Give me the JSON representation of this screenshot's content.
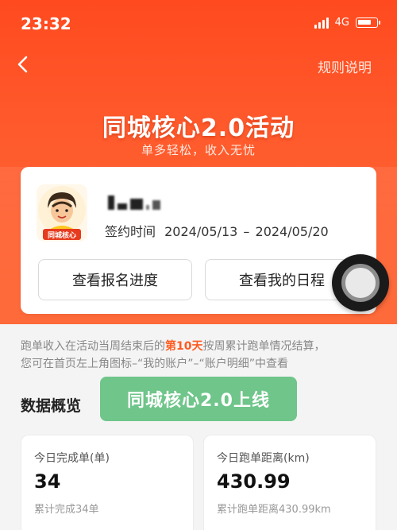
{
  "status_bar": {
    "time": "23:32",
    "network": "4G"
  },
  "nav": {
    "rules_label": "规则说明"
  },
  "hero": {
    "title": "同城核心2.0活动",
    "subtitle": "单多轻松，收入无忧"
  },
  "profile": {
    "avatar_text": "同城核心",
    "contract_label": "签约时间",
    "contract_start": "2024/05/13",
    "contract_sep": "–",
    "contract_end": "2024/05/20"
  },
  "buttons": {
    "progress": "查看报名进度",
    "schedule": "查看我的日程"
  },
  "notice": {
    "part1": "跑单收入在活动当周结束后的",
    "highlight": "第10天",
    "part2": "按周累计跑单情况结算，",
    "line2": "您可在首页左上角图标–“我的账户”–“账户明细”中查看"
  },
  "section": {
    "title": "数据概览"
  },
  "toast": {
    "text": "同城核心2.0上线"
  },
  "stats": [
    {
      "label": "今日完成单(单)",
      "value": "34",
      "sub": "累计完成34单"
    },
    {
      "label": "今日跑单距离(km)",
      "value": "430.99",
      "sub": "累计跑单距离430.99km"
    }
  ],
  "colors": {
    "brand": "#ff4a1f",
    "highlight": "#ff5a1f",
    "toast": "#6fc58a"
  },
  "icons": {
    "back": "chevron-left-icon",
    "signal": "signal-icon",
    "battery": "battery-icon",
    "assistive": "assistive-touch-icon"
  }
}
